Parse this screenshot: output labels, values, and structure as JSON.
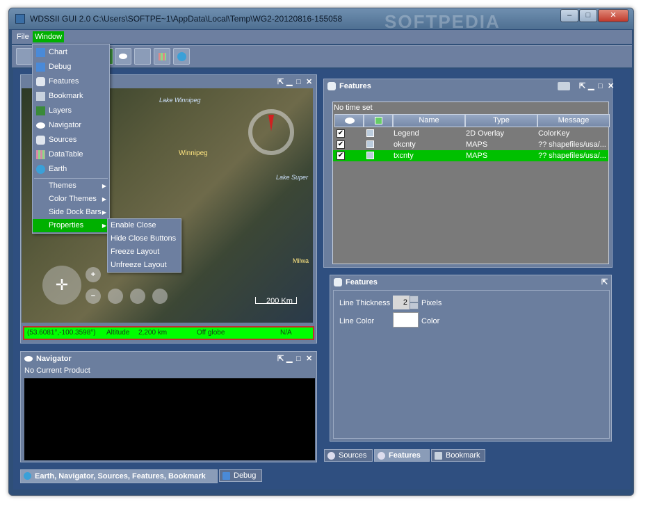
{
  "window": {
    "title": "WDSSII GUI 2.0 C:\\Users\\SOFTPE~1\\AppData\\Local\\Temp\\WG2-20120816-155058",
    "minimize": "‒",
    "maximize": "□",
    "close": "✕"
  },
  "menubar": {
    "file": "File",
    "window": "Window"
  },
  "window_menu": {
    "items": [
      {
        "label": "Chart",
        "icon": "chart-icon",
        "color": "#4a8ad8"
      },
      {
        "label": "Debug",
        "icon": "debug-icon",
        "color": "#4a8ad8"
      },
      {
        "label": "Features",
        "icon": "features-icon",
        "color": "#e0e6ee"
      },
      {
        "label": "Bookmark",
        "icon": "bookmark-cart-icon",
        "color": "#c8d2de"
      },
      {
        "label": "Layers",
        "icon": "layers-icon",
        "color": "#3a8a3a"
      },
      {
        "label": "Navigator",
        "icon": "eye-icon",
        "color": "#ffffff"
      },
      {
        "label": "Sources",
        "icon": "sources-icon",
        "color": "#e0e6ee"
      },
      {
        "label": "DataTable",
        "icon": "datatable-icon",
        "color": "#d88aa8"
      },
      {
        "label": "Earth",
        "icon": "earth-icon",
        "color": "#3aa0d8"
      }
    ],
    "submenus": [
      {
        "label": "Themes"
      },
      {
        "label": "Color Themes"
      },
      {
        "label": "Side Dock Bars"
      },
      {
        "label": "Properties"
      }
    ],
    "arrow": "▶"
  },
  "properties_menu": {
    "items": [
      "Enable Close",
      "Hide Close Buttons",
      "Freeze Layout",
      "Unfreeze Layout"
    ]
  },
  "earth_panel": {
    "controls": {
      "pin": "⇱",
      "min": "▁",
      "max": "□",
      "close": "✕"
    },
    "map_labels": [
      "Lake Winnipeg",
      "Winnipeg",
      "Lake Super",
      "Milwa"
    ],
    "scale": "200 Km",
    "status": {
      "coords": "(53.6081°,-100.3598°)",
      "altitude_label": "Altitude",
      "altitude": "2,200 km",
      "globe": "Off globe",
      "na": "N/A"
    }
  },
  "navigator_panel": {
    "title": "Navigator",
    "message": "No Current Product"
  },
  "features_panel": {
    "title": "Features",
    "time": "No time set",
    "columns": [
      "Name",
      "Type",
      "Message"
    ],
    "rows": [
      {
        "checked": "✔",
        "name": "Legend",
        "type": "2D Overlay",
        "message": "ColorKey",
        "selected": false
      },
      {
        "checked": "✔",
        "name": "okcnty",
        "type": "MAPS",
        "message": "?? shapefiles/usa/...",
        "selected": false
      },
      {
        "checked": "✔",
        "name": "txcnty",
        "type": "MAPS",
        "message": "?? shapefiles/usa/...",
        "selected": true
      }
    ],
    "tabs": [
      "Sources",
      "Features",
      "Bookmark"
    ]
  },
  "features_props": {
    "title": "Features",
    "line_thickness_label": "Line Thickness",
    "line_thickness_value": "2",
    "pixels_label": "Pixels",
    "line_color_label": "Line Color",
    "color_label": "Color",
    "line_color": "#ffffff"
  },
  "bottom_tabs": [
    "Earth, Navigator, Sources, Features, Bookmark",
    "Debug"
  ],
  "watermark": "SOFTPEDIA",
  "colors": {
    "highlight": "#00c000",
    "accent": "#6d7fa0"
  }
}
